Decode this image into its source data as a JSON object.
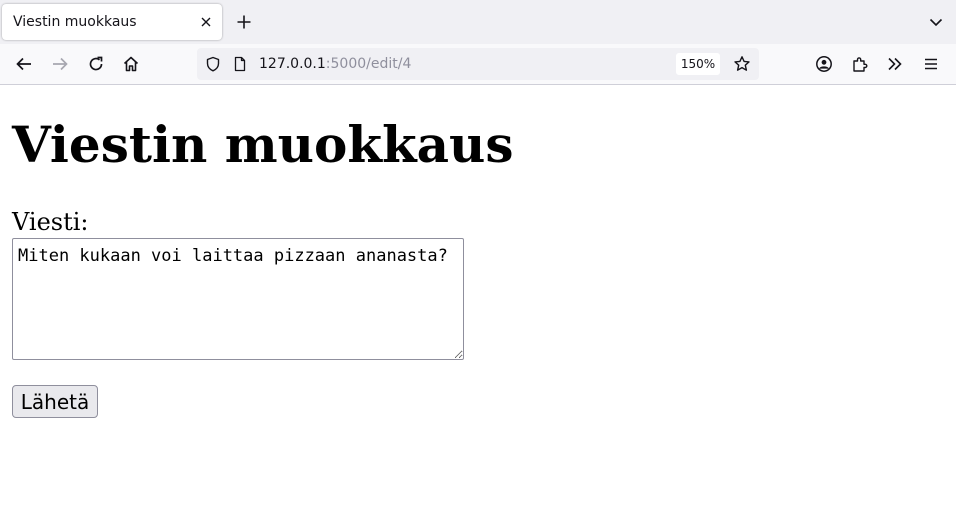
{
  "browser": {
    "tab_title": "Viestin muokkaus",
    "url_host": "127.0.0.1",
    "url_path": ":5000/edit/4",
    "zoom": "150%"
  },
  "page": {
    "heading": "Viestin muokkaus",
    "message_label": "Viesti:",
    "message_value": "Miten kukaan voi laittaa pizzaan ananasta?",
    "submit_label": "Lähetä"
  }
}
